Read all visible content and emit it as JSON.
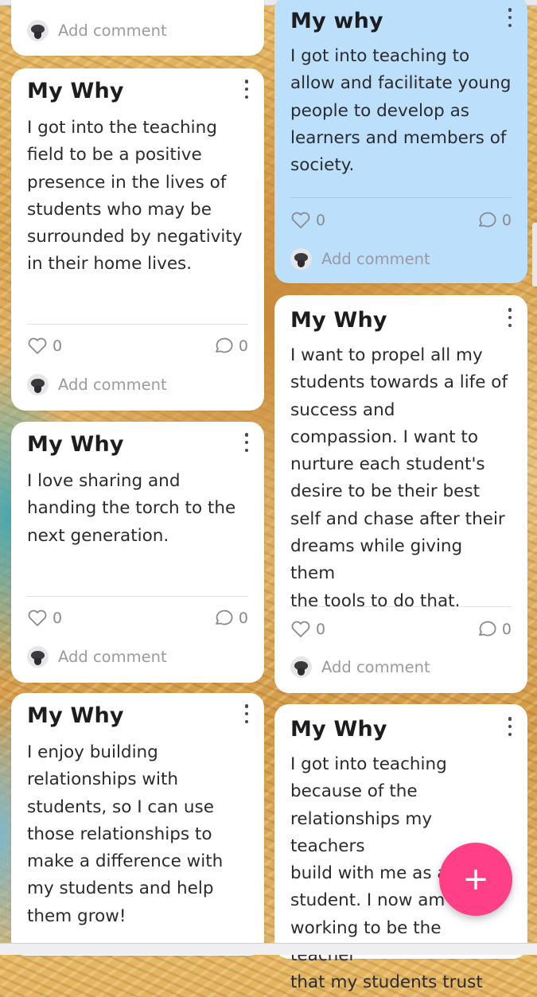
{
  "cards": {
    "top_partial": {
      "add_comment": "Add comment"
    },
    "left1": {
      "title": "My Why",
      "body": [
        "I got into the teaching",
        "field to be a positive",
        "presence in the lives of",
        "students who may be",
        "surrounded by negativity",
        "in their home lives."
      ],
      "likes": "0",
      "comments": "0",
      "add_comment": "Add comment"
    },
    "left2": {
      "title": "My Why",
      "body": [
        "I love sharing and",
        "handing the torch to the",
        "next generation."
      ],
      "likes": "0",
      "comments": "0",
      "add_comment": "Add comment"
    },
    "left3": {
      "title": "My Why",
      "body": [
        "I enjoy building",
        "relationships with",
        "students, so I can use",
        "those relationships to",
        "make a difference with",
        "my students and help",
        "them grow!"
      ]
    },
    "right1": {
      "title": "My why",
      "body": [
        "I got into teaching to",
        "allow and facilitate young",
        "people to develop as",
        "learners and members of",
        "society."
      ],
      "likes": "0",
      "comments": "0",
      "add_comment": "Add comment",
      "color": "#bcdffb"
    },
    "right2": {
      "title": "My Why",
      "body": [
        "I want to propel all my",
        "students towards a life of",
        "success and",
        "compassion. I want to",
        "nurture each student's",
        "desire to be their best",
        "self and chase after their",
        "dreams while giving them",
        "the tools to do that."
      ],
      "likes": "0",
      "comments": "0",
      "add_comment": "Add comment"
    },
    "right3": {
      "title": "My Why",
      "body": [
        "I got into teaching",
        "because of the",
        "relationships my teachers",
        "build with me as a",
        "student. I now am",
        "working to be the teacher",
        "that my students trust"
      ]
    }
  },
  "fab": {
    "label": "+",
    "color": "#ff3f86"
  },
  "icons": {
    "like": "heart-icon",
    "comment": "comment-bubble-icon",
    "menu": "more-vertical-icon",
    "avatar": "avatar-icon"
  }
}
